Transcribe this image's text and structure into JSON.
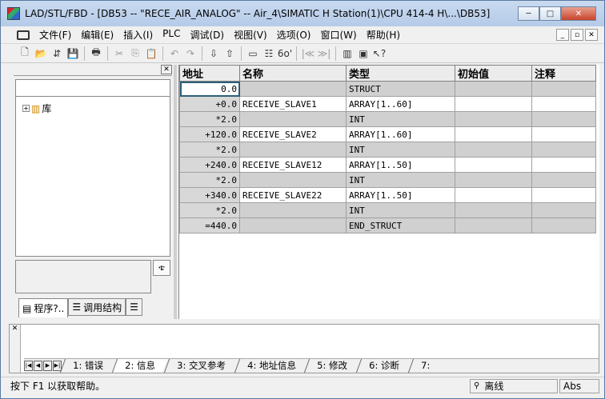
{
  "window": {
    "title": "LAD/STL/FBD  - [DB53 -- \"RECE_AIR_ANALOG\" -- Air_4\\SIMATIC H Station(1)\\CPU 414-4 H\\...\\DB53]",
    "controls": {
      "minimize": "─",
      "maximize": "□",
      "close": "✕"
    }
  },
  "menubar": {
    "items": [
      "文件(F)",
      "编辑(E)",
      "插入(I)",
      "PLC",
      "调试(D)",
      "视图(V)",
      "选项(O)",
      "窗口(W)",
      "帮助(H)"
    ],
    "mdi": {
      "minimize": "_",
      "restore": "▫",
      "close": "✕"
    }
  },
  "toolbar": {
    "icons": [
      {
        "name": "new-icon",
        "glyph": "🗋"
      },
      {
        "name": "open-icon",
        "glyph": "📂"
      },
      {
        "name": "network-icon",
        "glyph": "⇵"
      },
      {
        "name": "save-icon",
        "glyph": "💾"
      },
      {
        "name": "print-icon",
        "glyph": "🖶"
      },
      {
        "name": "cut-icon",
        "glyph": "✂"
      },
      {
        "name": "copy-icon",
        "glyph": "⎘"
      },
      {
        "name": "paste-icon",
        "glyph": "📋"
      },
      {
        "name": "undo-icon",
        "glyph": "↶"
      },
      {
        "name": "redo-icon",
        "glyph": "↷"
      },
      {
        "name": "download-icon",
        "glyph": "⇩"
      },
      {
        "name": "upload-icon",
        "glyph": "⇧"
      },
      {
        "name": "monitor-icon",
        "glyph": "▭"
      },
      {
        "name": "accessible-nodes-icon",
        "glyph": "☷"
      },
      {
        "name": "glasses-icon",
        "glyph": "6o'"
      },
      {
        "name": "prev-icon",
        "glyph": "|≪"
      },
      {
        "name": "next-icon",
        "glyph": "≫|"
      },
      {
        "name": "overview-icon",
        "glyph": "▥"
      },
      {
        "name": "details-icon",
        "glyph": "▣"
      },
      {
        "name": "help-pointer-icon",
        "glyph": "↖?"
      }
    ]
  },
  "left_panel": {
    "tree": {
      "toggle": "+",
      "label": "库"
    },
    "tabs": [
      "程序?..",
      "调用结构"
    ]
  },
  "grid": {
    "columns": [
      "地址",
      "名称",
      "类型",
      "初始值",
      "注释"
    ],
    "rows": [
      {
        "addr": "0.0",
        "name": "",
        "type": "STRUCT",
        "init": "",
        "comment": ""
      },
      {
        "addr": "+0.0",
        "name": "RECEIVE_SLAVE1",
        "type": "ARRAY[1..60]",
        "init": "",
        "comment": ""
      },
      {
        "addr": "*2.0",
        "name": "",
        "type": "INT",
        "init": "",
        "comment": ""
      },
      {
        "addr": "+120.0",
        "name": "RECEIVE_SLAVE2",
        "type": "ARRAY[1..60]",
        "init": "",
        "comment": ""
      },
      {
        "addr": "*2.0",
        "name": "",
        "type": "INT",
        "init": "",
        "comment": ""
      },
      {
        "addr": "+240.0",
        "name": "RECEIVE_SLAVE12",
        "type": "ARRAY[1..50]",
        "init": "",
        "comment": ""
      },
      {
        "addr": "*2.0",
        "name": "",
        "type": "INT",
        "init": "",
        "comment": ""
      },
      {
        "addr": "+340.0",
        "name": "RECEIVE_SLAVE22",
        "type": "ARRAY[1..50]",
        "init": "",
        "comment": ""
      },
      {
        "addr": "*2.0",
        "name": "",
        "type": "INT",
        "init": "",
        "comment": ""
      },
      {
        "addr": "=440.0",
        "name": "",
        "type": "END_STRUCT",
        "init": "",
        "comment": ""
      }
    ]
  },
  "output": {
    "tabs": [
      "1: 错误",
      "2: 信息",
      "3: 交叉参考",
      "4: 地址信息",
      "5: 修改",
      "6: 诊断",
      "7:"
    ],
    "active_tab": 1
  },
  "statusbar": {
    "help": "按下 F1 以获取帮助。",
    "mode": "离线",
    "abs": "Abs"
  }
}
